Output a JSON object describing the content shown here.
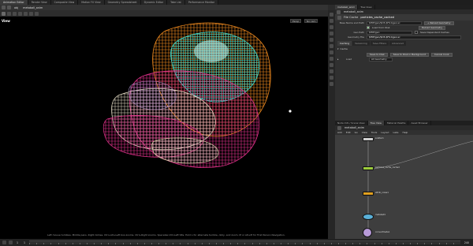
{
  "desktop_tabs": [
    "Animation Editor",
    "Render View",
    "Composite View",
    "Motion FX View",
    "Geometry Spreadsheet",
    "Dynamic Editor",
    "Take List",
    "Performance Monitor"
  ],
  "viewport_path": {
    "obj": "obj",
    "node": "metaball_anim"
  },
  "viewport": {
    "label": "View",
    "persp_button": "Persp",
    "cam_button": "No cam",
    "hint": "Left mouse tumbles. Middle pans. Right dollies. Ctrl+Alt+Left box-zooms. Ctrl+Right zooms. Spacebar-Ctrl-Left tilts. Hold L for alternate tumble, dolly, and zoom. M or Alt+M for First Person Navigation."
  },
  "param_panel": {
    "tabs": [
      "metaball_anim",
      "Tree View"
    ],
    "path": "metaball_anim",
    "node_type": "File Cache",
    "node_name": "particles_cache_cached",
    "rows": [
      {
        "label": "Base Name and Path",
        "value": "$HIP/geo/$OS.$F4.bgeo.sc",
        "button": "+ Reload Geometry"
      },
      {
        "label": "",
        "value": "Load from Disk",
        "button": "Reload Geometry"
      },
      {
        "label": "Geo Path",
        "value": "$HIP/geo",
        "button": "Save Dependent Caches"
      },
      {
        "label": "Geometry File",
        "value": "$HIP/geo/$OS.$F4.bgeo.sc"
      }
    ],
    "subtabs": [
      "Caching",
      "Versioning",
      "Save Filters",
      "Advanced"
    ],
    "active_subtab": "Caching",
    "section_label": "Cache",
    "buttons": [
      "Save to Disk",
      "Save to Disk in Background",
      "Cancel Cook"
    ],
    "load_label": "Load",
    "load_value": "All Geometry"
  },
  "network": {
    "tabs": [
      "Node Info / Scene View",
      "Tree View",
      "Material Palette",
      "Asset Browser"
    ],
    "path": "metaball_anim",
    "menu": [
      "Add",
      "Edit",
      "Go",
      "View",
      "Tools",
      "Layout",
      "Labs",
      "Help"
    ],
    "nodes": [
      {
        "name": "scatter1",
        "color": "#cfcfcf"
      },
      {
        "name": "particles_cache_cached",
        "color": "#9ccc3c"
      },
      {
        "name": "attrib_noise1",
        "color": "#e0a020"
      },
      {
        "name": "metaball1",
        "color": "#5ab0d8"
      },
      {
        "name": "convertmeta1",
        "color": "#b79ad8"
      }
    ]
  },
  "timeline": {
    "frame_label": "1",
    "start_frame": "1",
    "end_frame": "240"
  },
  "colors": {
    "accent": "#e0a020",
    "viewport_bg": "#000000"
  }
}
